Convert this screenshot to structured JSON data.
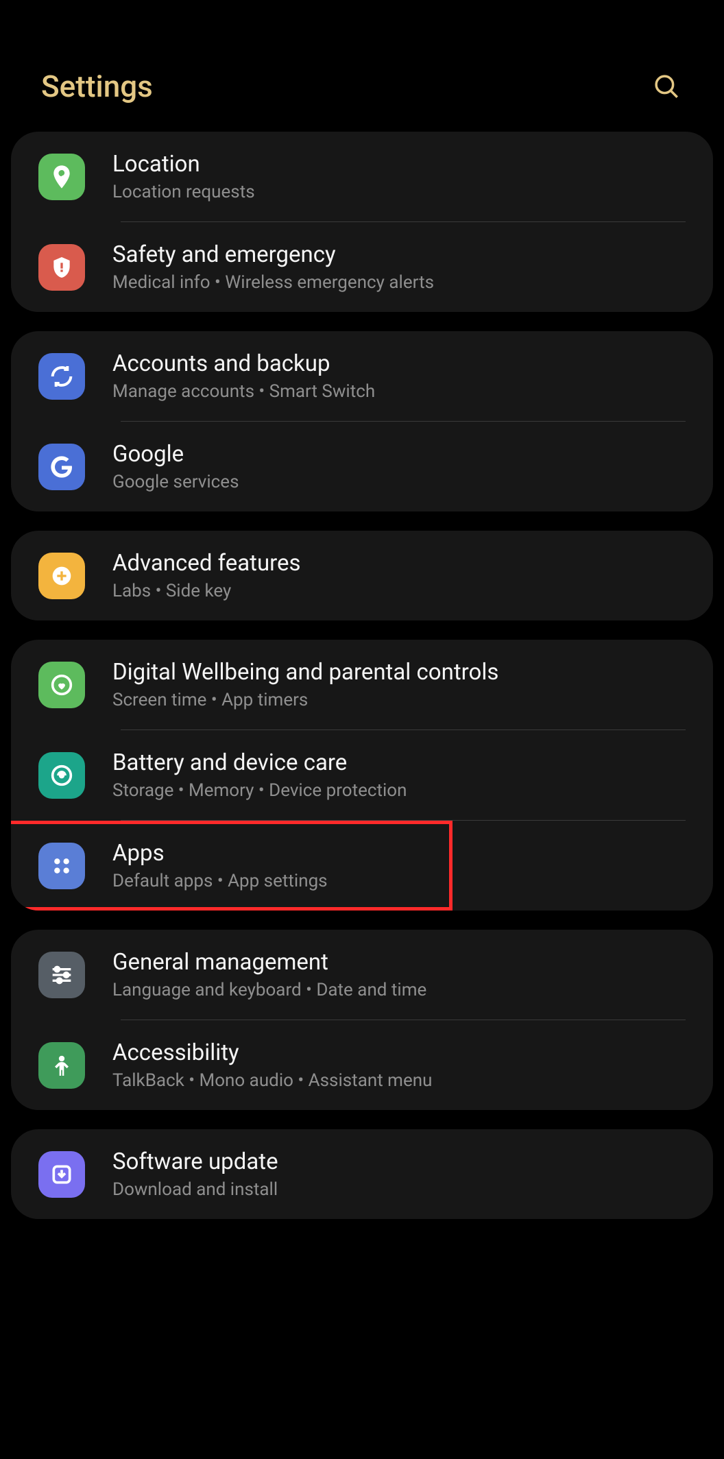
{
  "header": {
    "title": "Settings"
  },
  "groups": [
    {
      "items": [
        {
          "id": "location",
          "title": "Location",
          "sub": "Location requests",
          "iconClass": "ic-green",
          "icon": "location"
        },
        {
          "id": "safety",
          "title": "Safety and emergency",
          "sub": "Medical info  •  Wireless emergency alerts",
          "iconClass": "ic-red",
          "icon": "safety"
        }
      ]
    },
    {
      "items": [
        {
          "id": "accounts",
          "title": "Accounts and backup",
          "sub": "Manage accounts  •  Smart Switch",
          "iconClass": "ic-blue",
          "icon": "sync"
        },
        {
          "id": "google",
          "title": "Google",
          "sub": "Google services",
          "iconClass": "ic-blue",
          "icon": "google"
        }
      ]
    },
    {
      "items": [
        {
          "id": "advanced",
          "title": "Advanced features",
          "sub": "Labs  •  Side key",
          "iconClass": "ic-orange",
          "icon": "plusgear"
        }
      ]
    },
    {
      "items": [
        {
          "id": "wellbeing",
          "title": "Digital Wellbeing and parental controls",
          "sub": "Screen time  •  App timers",
          "iconClass": "ic-green",
          "icon": "wellbeing"
        },
        {
          "id": "battery",
          "title": "Battery and device care",
          "sub": "Storage  •  Memory  •  Device protection",
          "iconClass": "ic-teal",
          "icon": "battery"
        },
        {
          "id": "apps",
          "title": "Apps",
          "sub": "Default apps  •  App settings",
          "iconClass": "ic-blue2",
          "icon": "apps",
          "highlight": true
        }
      ]
    },
    {
      "items": [
        {
          "id": "general",
          "title": "General management",
          "sub": "Language and keyboard  •  Date and time",
          "iconClass": "ic-gray",
          "icon": "sliders"
        },
        {
          "id": "accessibility",
          "title": "Accessibility",
          "sub": "TalkBack  •  Mono audio  •  Assistant menu",
          "iconClass": "ic-green3",
          "icon": "person"
        }
      ]
    },
    {
      "items": [
        {
          "id": "software",
          "title": "Software update",
          "sub": "Download and install",
          "iconClass": "ic-purple",
          "icon": "update"
        }
      ]
    }
  ]
}
